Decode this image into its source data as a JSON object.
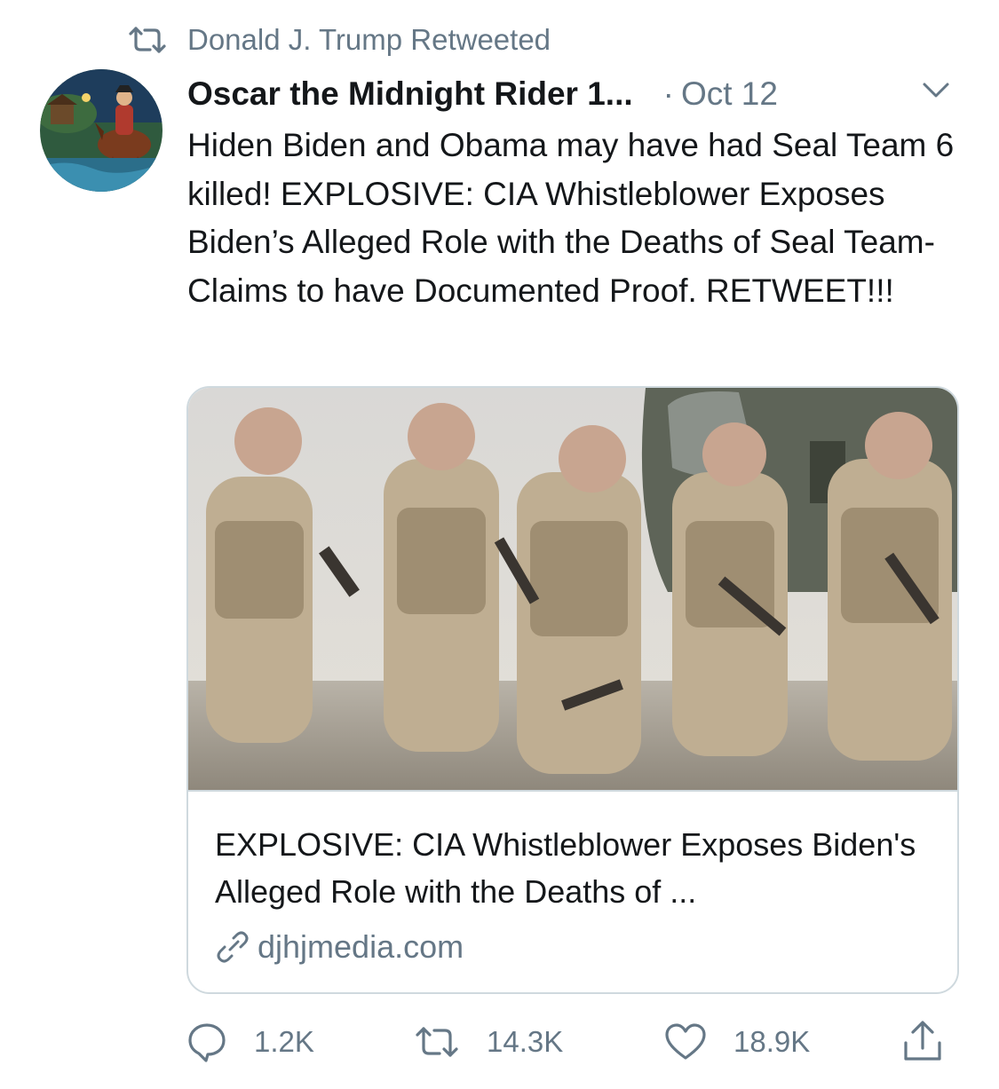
{
  "retweet_header": {
    "text": "Donald J. Trump Retweeted",
    "icon": "retweet-icon"
  },
  "author": {
    "display_name": "Oscar the Midnight Rider 1...",
    "separator": "·",
    "date": "Oct 12",
    "avatar": "avatar-painting"
  },
  "tweet": {
    "text": "Hiden Biden and Obama may have had Seal Team 6 killed! EXPLOSIVE: CIA Whistleblower Exposes Biden’s Alleged Role with the Deaths of Seal Team- Claims to have Documented Proof. RETWEET!!!"
  },
  "card": {
    "title": "EXPLOSIVE: CIA Whistleblower Exposes Biden's Alleged Role with the Deaths of ...",
    "domain": "djhjmedia.com",
    "domain_icon": "link-icon"
  },
  "actions": {
    "replies": "1.2K",
    "retweets": "14.3K",
    "likes": "18.9K"
  },
  "colors": {
    "secondary_text": "#657786",
    "primary_text": "#14171a",
    "card_border": "#cfd9de"
  }
}
